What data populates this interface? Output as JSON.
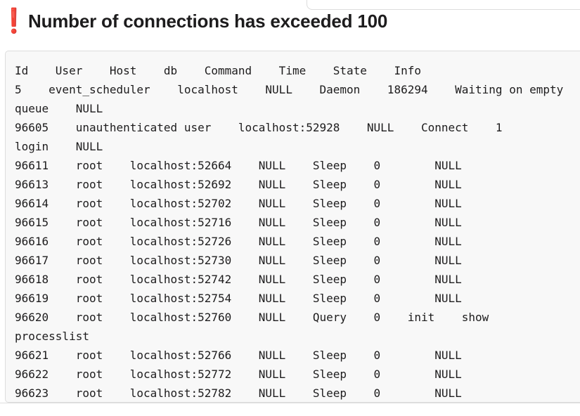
{
  "heading": {
    "icon": "exclamation-icon",
    "icon_glyph": "❗",
    "icon_color": "#e0252e",
    "title": "Number of connections has exceeded 100"
  },
  "code_block": {
    "lines": [
      "Id    User    Host    db    Command    Time    State    Info",
      "5    event_scheduler    localhost    NULL    Daemon    186294    Waiting on empty",
      "queue    NULL",
      "96605    unauthenticated user    localhost:52928    NULL    Connect    1",
      "login    NULL",
      "96611    root    localhost:52664    NULL    Sleep    0        NULL",
      "96613    root    localhost:52692    NULL    Sleep    0        NULL",
      "96614    root    localhost:52702    NULL    Sleep    0        NULL",
      "96615    root    localhost:52716    NULL    Sleep    0        NULL",
      "96616    root    localhost:52726    NULL    Sleep    0        NULL",
      "96617    root    localhost:52730    NULL    Sleep    0        NULL",
      "96618    root    localhost:52742    NULL    Sleep    0        NULL",
      "96619    root    localhost:52754    NULL    Sleep    0        NULL",
      "96620    root    localhost:52760    NULL    Query    0    init    show",
      "processlist",
      "96621    root    localhost:52766    NULL    Sleep    0        NULL",
      "96622    root    localhost:52772    NULL    Sleep    0        NULL",
      "96623    root    localhost:52782    NULL    Sleep    0        NULL"
    ]
  }
}
